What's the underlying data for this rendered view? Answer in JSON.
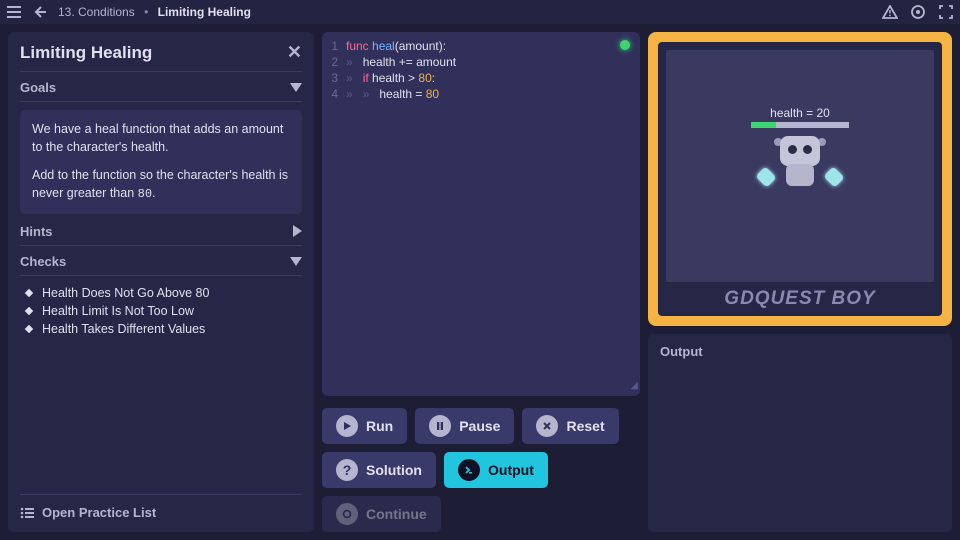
{
  "breadcrumb": {
    "chapter": "13. Conditions",
    "lesson": "Limiting Healing"
  },
  "sidebar": {
    "title": "Limiting Healing",
    "goals": {
      "label": "Goals",
      "p1": "We have a heal function that adds an amount to the character's health.",
      "p2a": "Add to the function so the character's health is never greater than ",
      "p2code": "80",
      "p2b": "."
    },
    "hints_label": "Hints",
    "checks": {
      "label": "Checks",
      "items": [
        "Health Does Not Go Above 80",
        "Health Limit Is Not Too Low",
        "Health Takes Different Values"
      ]
    },
    "open_list": "Open Practice List"
  },
  "code": {
    "lines": [
      {
        "n": "1",
        "tokens": [
          [
            "kw",
            "func"
          ],
          [
            "",
            " "
          ],
          [
            "fn",
            "heal"
          ],
          [
            "",
            "(amount):"
          ]
        ]
      },
      {
        "n": "2",
        "tokens": [
          [
            "ws",
            "»   "
          ],
          [
            "",
            "health += amount"
          ]
        ]
      },
      {
        "n": "3",
        "tokens": [
          [
            "ws",
            "»   "
          ],
          [
            "kw",
            "if"
          ],
          [
            "",
            " health > "
          ],
          [
            "nm",
            "80"
          ],
          [
            "",
            ":"
          ]
        ]
      },
      {
        "n": "4",
        "tokens": [
          [
            "ws",
            "»   "
          ],
          [
            "ws",
            "»   "
          ],
          [
            "",
            "health = "
          ],
          [
            "nm",
            "80"
          ]
        ]
      }
    ],
    "status": "ok"
  },
  "buttons": {
    "run": "Run",
    "pause": "Pause",
    "reset": "Reset",
    "solution": "Solution",
    "output": "Output",
    "continue": "Continue"
  },
  "game": {
    "health_label": "health = 20",
    "health_value": 20,
    "health_max": 80,
    "brand": "GDQUEST BOY"
  },
  "output": {
    "label": "Output"
  }
}
